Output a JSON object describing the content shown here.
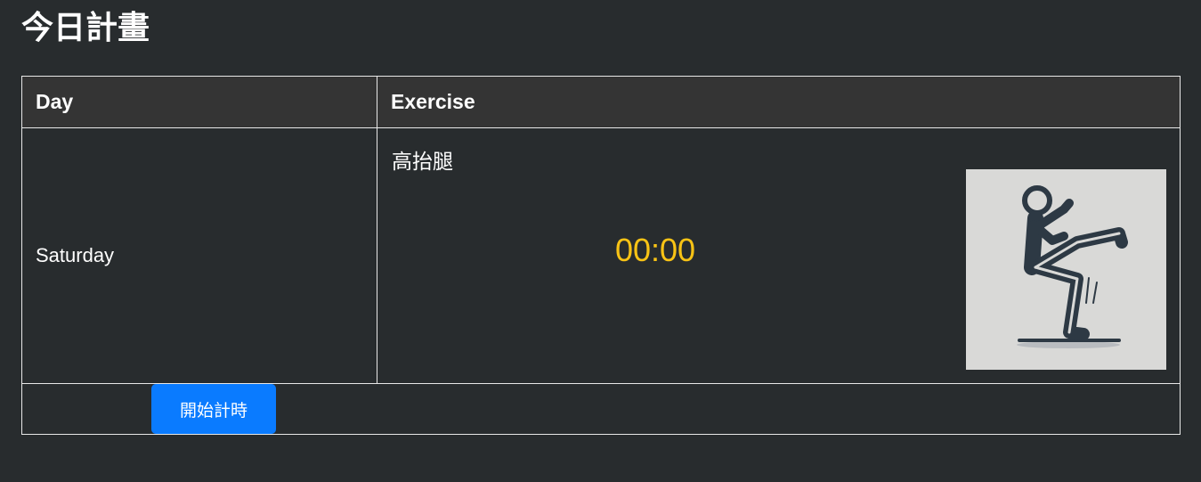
{
  "page": {
    "title": "今日計畫"
  },
  "table": {
    "headers": {
      "day": "Day",
      "exercise": "Exercise"
    },
    "rows": [
      {
        "day": "Saturday",
        "exercise_name": "高抬腿",
        "timer": "00:00",
        "image_icon": "high-knees-figure-icon"
      }
    ]
  },
  "actions": {
    "start_timer_label": "開始計時"
  },
  "colors": {
    "background": "#282c2e",
    "header_background": "#343434",
    "timer": "#f8c315",
    "button": "#0a7bff",
    "border": "#e8e8e8"
  }
}
